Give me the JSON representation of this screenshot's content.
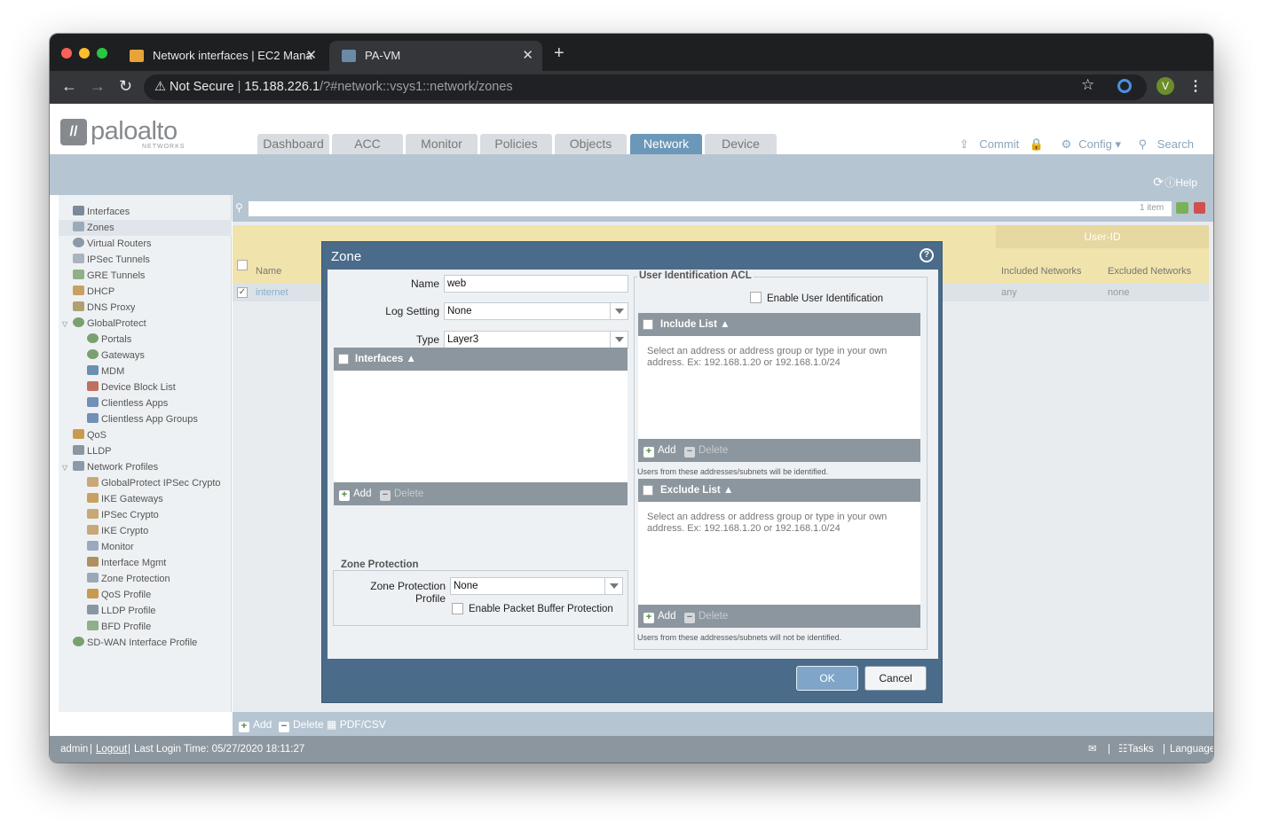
{
  "browser": {
    "tabs": [
      {
        "title": "Network interfaces | EC2 Mana"
      },
      {
        "title": "PA-VM"
      }
    ],
    "security_label": "Not Secure",
    "url_host": "15.188.226.1",
    "url_path": "/?#network::vsys1::network/zones",
    "profile_initial": "V"
  },
  "app": {
    "logo_text": "paloalto",
    "logo_sub": "NETWORKS",
    "main_tabs": [
      "Dashboard",
      "ACC",
      "Monitor",
      "Policies",
      "Objects",
      "Network",
      "Device"
    ],
    "active_tab": "Network",
    "tools": {
      "commit": "Commit",
      "config": "Config",
      "search": "Search"
    },
    "help": "Help",
    "sidebar": [
      "Interfaces",
      "Zones",
      "Virtual Routers",
      "IPSec Tunnels",
      "GRE Tunnels",
      "DHCP",
      "DNS Proxy",
      "GlobalProtect",
      "Portals",
      "Gateways",
      "MDM",
      "Device Block List",
      "Clientless Apps",
      "Clientless App Groups",
      "QoS",
      "LLDP",
      "Network Profiles",
      "GlobalProtect IPSec Crypto",
      "IKE Gateways",
      "IPSec Crypto",
      "IKE Crypto",
      "Monitor",
      "Interface Mgmt",
      "Zone Protection",
      "QoS Profile",
      "LLDP Profile",
      "BFD Profile",
      "SD-WAN Interface Profile"
    ],
    "table": {
      "count": "1 item",
      "group_header": "User-ID",
      "columns": {
        "name": "Name",
        "included": "Included Networks",
        "excluded": "Excluded Networks"
      },
      "rows": [
        {
          "name": "internet",
          "included": "any",
          "excluded": "none"
        }
      ]
    },
    "bottom_bar": {
      "add": "Add",
      "delete": "Delete",
      "pdf": "PDF/CSV"
    },
    "status": {
      "user": "admin",
      "logout": "Logout",
      "last_login": "Last Login Time: 05/27/2020 18:11:27",
      "tasks": "Tasks",
      "language": "Language"
    }
  },
  "dialog": {
    "title": "Zone",
    "name_label": "Name",
    "name_value": "web",
    "log_label": "Log Setting",
    "log_value": "None",
    "type_label": "Type",
    "type_value": "Layer3",
    "interfaces_header": "Interfaces",
    "add": "Add",
    "delete": "Delete",
    "zone_protection_legend": "Zone Protection",
    "zpp_label": "Zone Protection Profile",
    "zpp_value": "None",
    "packet_buffer_label": "Enable Packet Buffer Protection",
    "uid_legend": "User Identification ACL",
    "enable_uid_label": "Enable User Identification",
    "include_header": "Include List",
    "include_hint": "Select an address or address group or type in your own address. Ex: 192.168.1.20 or 192.168.1.0/24",
    "include_note": "Users from these addresses/subnets will be identified.",
    "exclude_header": "Exclude List",
    "exclude_hint": "Select an address or address group or type in your own address. Ex: 192.168.1.20 or 192.168.1.0/24",
    "exclude_note": "Users from these addresses/subnets will not be identified.",
    "ok": "OK",
    "cancel": "Cancel"
  }
}
